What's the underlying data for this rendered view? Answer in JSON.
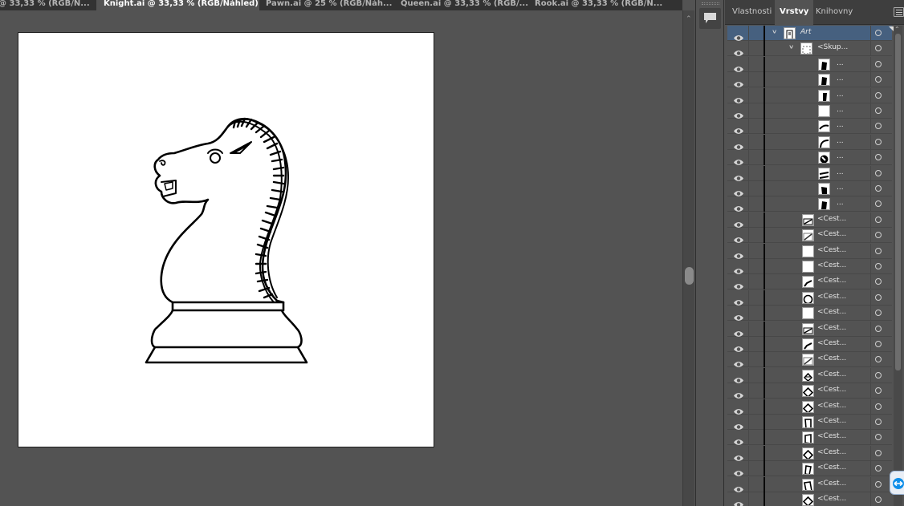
{
  "tabs": [
    {
      "label": "@ 33,33 % (RGB/N...",
      "close": "×",
      "active": false
    },
    {
      "label": "Knight.ai @ 33,33 % (RGB/Náhled)",
      "close": "×",
      "active": true
    },
    {
      "label": "Pawn.ai @ 25 % (RGB/Náh...",
      "close": "×",
      "active": false
    },
    {
      "label": "Queen.ai @ 33,33 % (RGB/...",
      "close": "×",
      "active": false
    },
    {
      "label": "Rook.ai @ 33,33 % (RGB/N...",
      "close": "×",
      "active": false
    }
  ],
  "panel": {
    "tabs": [
      "Vlastnosti",
      "Vrstvy",
      "Knihovny"
    ],
    "active_tab": "Vrstvy",
    "menu_icon": "hamburger-icon"
  },
  "layers": [
    {
      "label": "Art",
      "indent": 0,
      "expanded": true,
      "selected": true,
      "italic": true,
      "thumb": "doc"
    },
    {
      "label": "<Skup...",
      "indent": 1,
      "expanded": true,
      "selected": false,
      "italic": false,
      "thumb": "group"
    },
    {
      "label": "...",
      "indent": 2,
      "thumb": "blk1"
    },
    {
      "label": "...",
      "indent": 2,
      "thumb": "blk1"
    },
    {
      "label": "...",
      "indent": 2,
      "thumb": "blk2"
    },
    {
      "label": "...",
      "indent": 2,
      "thumb": "empty"
    },
    {
      "label": "...",
      "indent": 2,
      "thumb": "curve1"
    },
    {
      "label": "...",
      "indent": 2,
      "thumb": "curve2"
    },
    {
      "label": "...",
      "indent": 2,
      "thumb": "ring"
    },
    {
      "label": "...",
      "indent": 2,
      "thumb": "curve3"
    },
    {
      "label": "...",
      "indent": 2,
      "thumb": "blk3"
    },
    {
      "label": "...",
      "indent": 2,
      "thumb": "blk1"
    },
    {
      "label": "<Cest...",
      "indent": 3,
      "thumb": "slash"
    },
    {
      "label": "<Cest...",
      "indent": 3,
      "thumb": "slash2"
    },
    {
      "label": "<Cest...",
      "indent": 3,
      "thumb": "empty"
    },
    {
      "label": "<Cest...",
      "indent": 3,
      "thumb": "empty"
    },
    {
      "label": "<Cest...",
      "indent": 3,
      "thumb": "slash3"
    },
    {
      "label": "<Cest...",
      "indent": 3,
      "thumb": "circle"
    },
    {
      "label": "<Cest...",
      "indent": 3,
      "thumb": "empty"
    },
    {
      "label": "<Cest...",
      "indent": 3,
      "thumb": "slash"
    },
    {
      "label": "<Cest...",
      "indent": 3,
      "thumb": "slash3"
    },
    {
      "label": "<Cest...",
      "indent": 3,
      "thumb": "slash2"
    },
    {
      "label": "<Cest...",
      "indent": 3,
      "thumb": "diamond"
    },
    {
      "label": "<Cest...",
      "indent": 3,
      "thumb": "diamond2"
    },
    {
      "label": "<Cest...",
      "indent": 3,
      "thumb": "diamond2"
    },
    {
      "label": "<Cest...",
      "indent": 3,
      "thumb": "rect"
    },
    {
      "label": "<Cest...",
      "indent": 3,
      "thumb": "rect2"
    },
    {
      "label": "<Cest...",
      "indent": 3,
      "thumb": "diamond2"
    },
    {
      "label": "<Cest...",
      "indent": 3,
      "thumb": "rect3"
    },
    {
      "label": "<Cest...",
      "indent": 3,
      "thumb": "rect4"
    },
    {
      "label": "<Cest...",
      "indent": 3,
      "thumb": "diamond2"
    }
  ],
  "colors": {
    "ui_bg": "#535353",
    "tabbar_bg": "#323232",
    "selection": "#46607f",
    "layer_color": "#0a0a0a",
    "artboard": "#ffffff"
  },
  "icons": {
    "eye": "eye-icon",
    "target": "target-circle-icon",
    "comments": "comments-icon",
    "chevron": "chevron-down-icon",
    "remote": "teamviewer-icon"
  }
}
